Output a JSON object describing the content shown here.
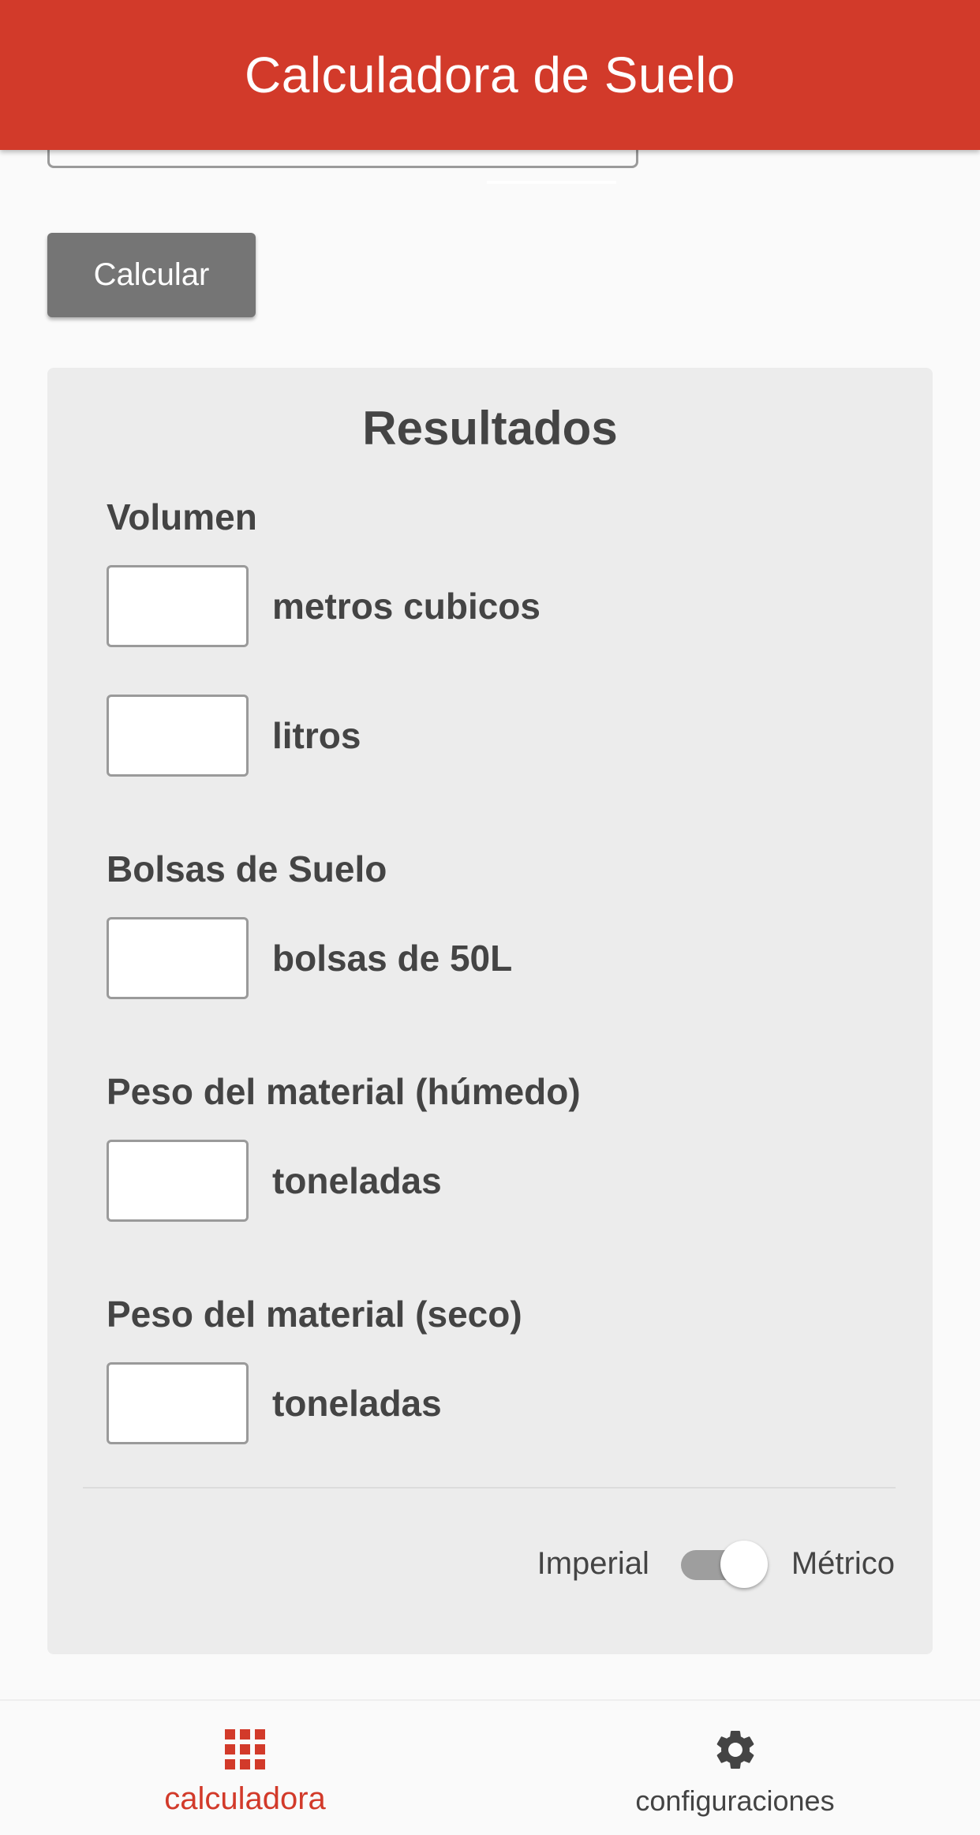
{
  "header": {
    "title": "Calculadora de Suelo"
  },
  "actions": {
    "calculate_label": "Calcular"
  },
  "results": {
    "title": "Resultados",
    "sections": [
      {
        "label": "Volumen",
        "rows": [
          {
            "value": "",
            "unit": "metros cubicos"
          },
          {
            "value": "",
            "unit": "litros"
          }
        ]
      },
      {
        "label": "Bolsas de Suelo",
        "rows": [
          {
            "value": "",
            "unit": "bolsas de 50L"
          }
        ]
      },
      {
        "label": "Peso del material (húmedo)",
        "rows": [
          {
            "value": "",
            "unit": "toneladas"
          }
        ]
      },
      {
        "label": "Peso del material (seco)",
        "rows": [
          {
            "value": "",
            "unit": "toneladas"
          }
        ]
      }
    ]
  },
  "unit_toggle": {
    "left_label": "Imperial",
    "right_label": "Métrico",
    "selected": "Métrico"
  },
  "bottom_nav": {
    "items": [
      {
        "label": "calculadora",
        "icon": "grid-icon",
        "active": true
      },
      {
        "label": "configuraciones",
        "icon": "gear-icon",
        "active": false
      }
    ]
  },
  "colors": {
    "accent": "#d23a2a",
    "button": "#757575",
    "card": "#ececec",
    "text": "#444444"
  }
}
